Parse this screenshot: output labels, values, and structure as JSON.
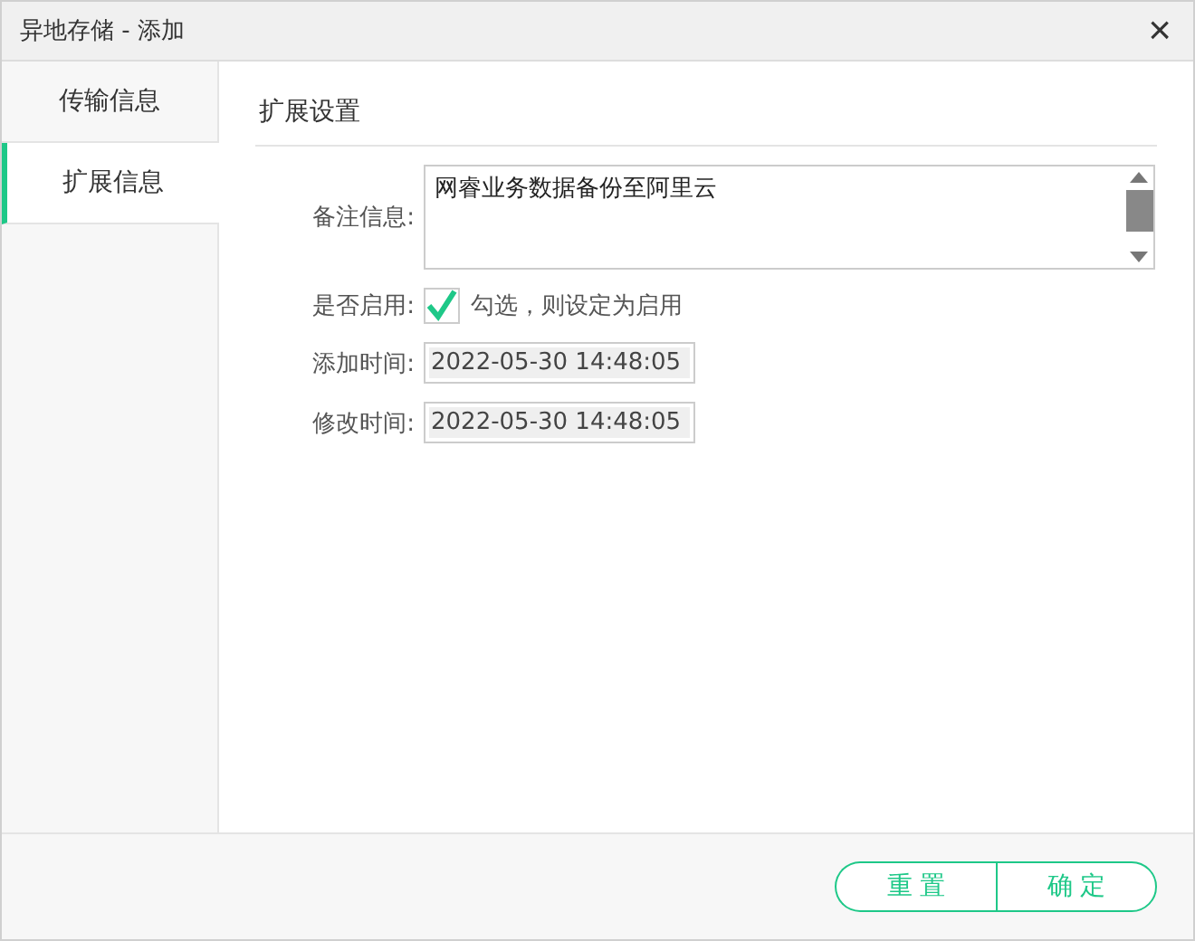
{
  "window": {
    "title": "异地存储 - 添加",
    "close": "×"
  },
  "tabs": [
    {
      "label": "传输信息",
      "selected": false
    },
    {
      "label": "扩展信息",
      "selected": true
    }
  ],
  "section": {
    "title": "扩展设置"
  },
  "form": {
    "remark": {
      "label": "备注信息:",
      "value": "网睿业务数据备份至阿里云"
    },
    "enabled": {
      "label": "是否启用:",
      "checked": true,
      "hint": "勾选，则设定为启用"
    },
    "added": {
      "label": "添加时间:",
      "value": "2022-05-30 14:48:05",
      "disabled": true
    },
    "modified": {
      "label": "修改时间:",
      "value": "2022-05-30 14:48:05",
      "disabled": true
    }
  },
  "buttons": [
    "重 置",
    "确 定"
  ]
}
